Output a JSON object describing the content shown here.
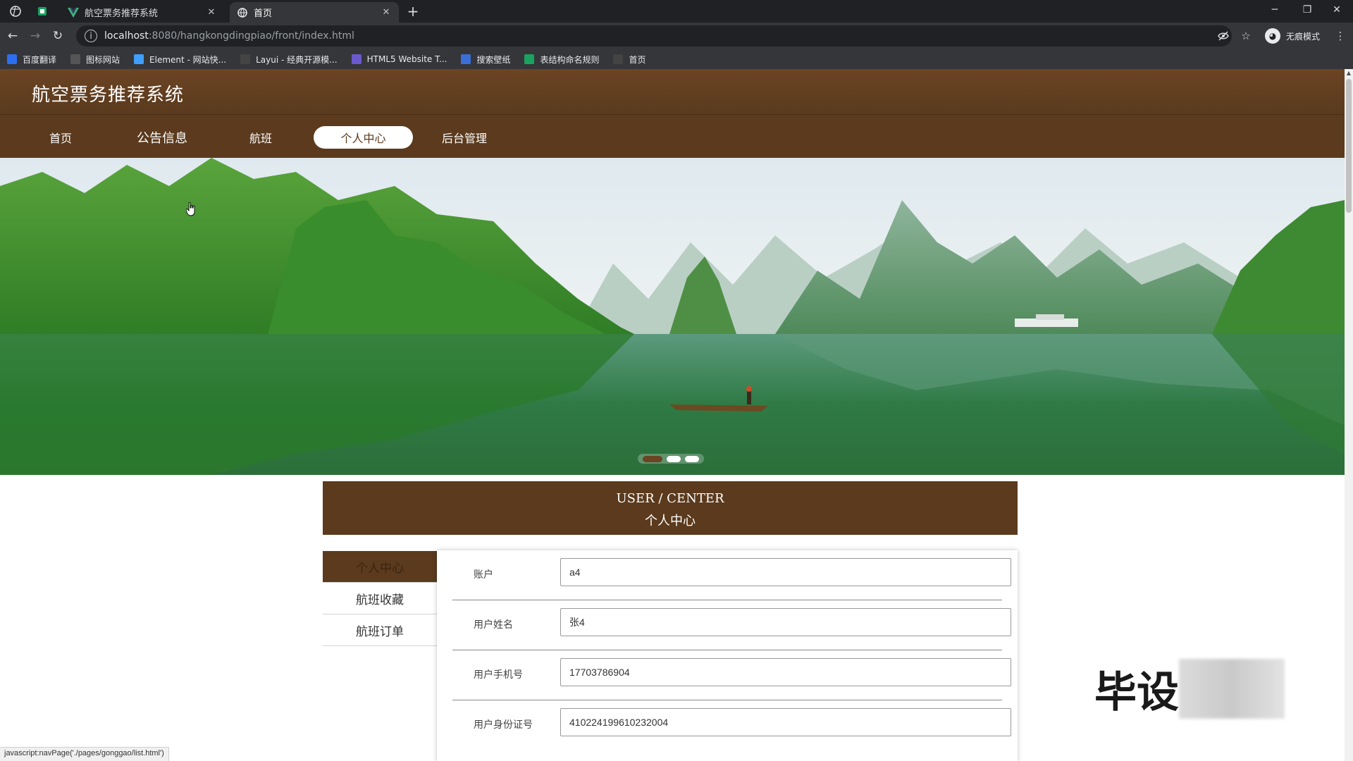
{
  "browser": {
    "tabs": [
      {
        "title": "航空票务推荐系统",
        "active": false
      },
      {
        "title": "首页",
        "active": true
      }
    ],
    "new_tab": "+",
    "url_host": "localhost",
    "url_path": ":8080/hangkongdingpiao/front/index.html",
    "incognito_label": "无痕模式",
    "bookmarks": [
      {
        "label": "百度翻译",
        "icon": "translate-icon",
        "color": "#2c6ef2"
      },
      {
        "label": "图标网站",
        "icon": "flag-icon",
        "color": "#555555"
      },
      {
        "label": "Element - 网站快...",
        "icon": "element-icon",
        "color": "#409eff"
      },
      {
        "label": "Layui - 经典开源模...",
        "icon": "layui-icon",
        "color": "#444444"
      },
      {
        "label": "HTML5 Website T...",
        "icon": "html5-icon",
        "color": "#6a5acd"
      },
      {
        "label": "搜索壁纸",
        "icon": "wallpaper-icon",
        "color": "#3b6fd8"
      },
      {
        "label": "表结构命名规则",
        "icon": "sheet-icon",
        "color": "#1aa260"
      },
      {
        "label": "首页",
        "icon": "globe-icon",
        "color": "#444444"
      }
    ]
  },
  "site": {
    "title": "航空票务推荐系统",
    "nav": [
      {
        "label": "首页",
        "active": false
      },
      {
        "label": "公告信息",
        "active": false
      },
      {
        "label": "航班",
        "active": false
      },
      {
        "label": "个人中心",
        "active": true
      },
      {
        "label": "后台管理",
        "active": false
      }
    ],
    "banner": {
      "slides": 3,
      "active_slide": 1
    }
  },
  "user_center": {
    "title_en": "USER / CENTER",
    "title_zh": "个人中心",
    "menu": [
      {
        "label": "个人中心",
        "active": true
      },
      {
        "label": "航班收藏",
        "active": false
      },
      {
        "label": "航班订单",
        "active": false
      }
    ],
    "fields": [
      {
        "label": "账户",
        "value": "a4"
      },
      {
        "label": "用户姓名",
        "value": "张4"
      },
      {
        "label": "用户手机号",
        "value": "17703786904"
      },
      {
        "label": "用户身份证号",
        "value": "410224199610232004"
      }
    ]
  },
  "status_bar": "javascript:navPage('./pages/gonggao/list.html')",
  "watermark": "毕设",
  "colors": {
    "brand_brown": "#5b3a1d",
    "header_brown": "#6b4423"
  }
}
